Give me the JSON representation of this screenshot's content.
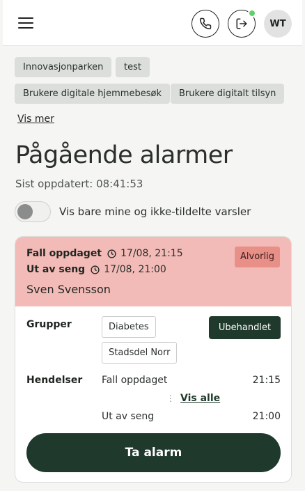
{
  "header": {
    "menu_icon": "hamburger-menu-icon",
    "phone_icon": "phone-icon",
    "logout_icon": "logout-icon",
    "status_color": "#5fd06a",
    "avatar_initials": "WT"
  },
  "filters": {
    "chips": [
      "Innovasjonparken",
      "test",
      "Brukere digitale hjemmebesøk",
      "Brukere digitalt tilsyn"
    ],
    "show_more": "Vis mer"
  },
  "page": {
    "title": "Pågående alarmer",
    "updated": "Sist oppdatert: 08:41:53"
  },
  "toggle": {
    "label": "Vis bare mine og ikke-tildelte varsler",
    "on": false
  },
  "alarm": {
    "header_color": "#f3bbb7",
    "lines": [
      {
        "title": "Fall oppdaget",
        "time": "17/08, 21:15"
      },
      {
        "title": "Ut av seng",
        "time": "17/08, 21:00"
      }
    ],
    "severity": "Alvorlig",
    "person": "Sven Svensson",
    "groups_label": "Grupper",
    "groups": [
      "Diabetes",
      "Stadsdel Norr"
    ],
    "status": "Ubehandlet",
    "events_label": "Hendelser",
    "events": [
      {
        "name": "Fall oppdaget",
        "time": "21:15"
      },
      {
        "name": "Ut av seng",
        "time": "21:00"
      }
    ],
    "show_all": "Vis alle",
    "action": "Ta alarm",
    "accent_color": "#1f3a2c"
  }
}
